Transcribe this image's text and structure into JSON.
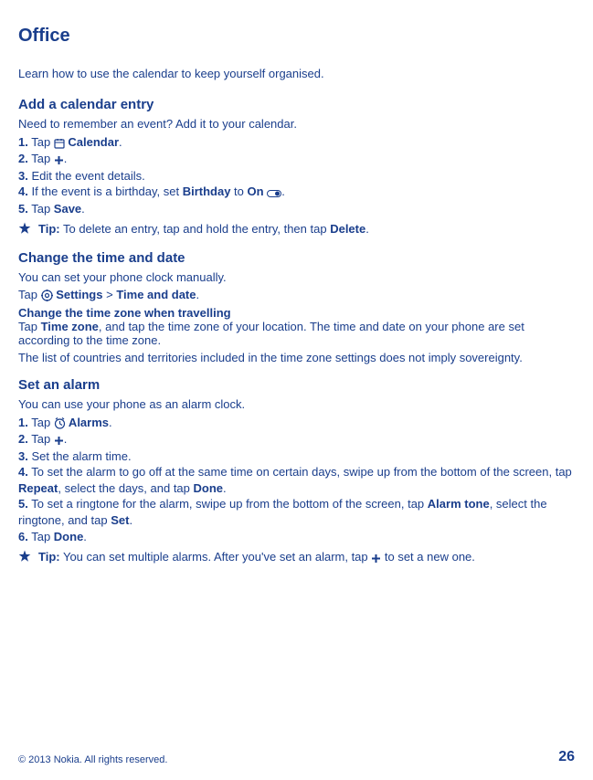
{
  "title": "Office",
  "intro": "Learn how to use the calendar to keep yourself organised.",
  "s1": {
    "h": "Add a calendar entry",
    "desc": "Need to remember an event? Add it to your calendar.",
    "step1_a": "1.",
    "step1_b": " Tap ",
    "step1_c": " Calendar",
    "step1_d": ".",
    "step2_a": "2.",
    "step2_b": " Tap ",
    "step2_c": ".",
    "step3_a": "3.",
    "step3_b": " Edit the event details.",
    "step4_a": "4.",
    "step4_b": " If the event is a birthday, set ",
    "step4_c": "Birthday",
    "step4_d": " to ",
    "step4_e": "On",
    "step4_f": " ",
    "step4_g": ".",
    "step5_a": "5.",
    "step5_b": " Tap ",
    "step5_c": "Save",
    "step5_d": ".",
    "tip_a": "Tip:",
    "tip_b": " To delete an entry, tap and hold the entry, then tap ",
    "tip_c": "Delete",
    "tip_d": "."
  },
  "s2": {
    "h": "Change the time and date",
    "desc": "You can set your phone clock manually.",
    "nav_a": "Tap ",
    "nav_b": " Settings",
    "nav_c": " > ",
    "nav_d": "Time and date",
    "nav_e": ".",
    "sub_h": "Change the time zone when travelling",
    "sub_a": "Tap ",
    "sub_b": "Time zone",
    "sub_c": ", and tap the time zone of your location. The time and date on your phone are set according to the time zone.",
    "note": "The list of countries and territories included in the time zone settings does not imply sovereignty."
  },
  "s3": {
    "h": "Set an alarm",
    "desc": "You can use your phone as an alarm clock.",
    "step1_a": "1.",
    "step1_b": " Tap ",
    "step1_c": " Alarms",
    "step1_d": ".",
    "step2_a": "2.",
    "step2_b": " Tap ",
    "step2_c": ".",
    "step3_a": "3.",
    "step3_b": " Set the alarm time.",
    "step4_a": "4.",
    "step4_b": " To set the alarm to go off at the same time on certain days, swipe up from the bottom of the screen, tap ",
    "step4_c": "Repeat",
    "step4_d": ", select the days, and tap ",
    "step4_e": "Done",
    "step4_f": ".",
    "step5_a": "5.",
    "step5_b": " To set a ringtone for the alarm, swipe up from the bottom of the screen, tap ",
    "step5_c": "Alarm tone",
    "step5_d": ", select the ringtone, and tap ",
    "step5_e": "Set",
    "step5_f": ".",
    "step6_a": "6.",
    "step6_b": " Tap ",
    "step6_c": "Done",
    "step6_d": ".",
    "tip_a": "Tip:",
    "tip_b": " You can set multiple alarms. After you've set an alarm, tap ",
    "tip_c": " to set a new one."
  },
  "footer": {
    "copyright": "© 2013 Nokia. All rights reserved.",
    "page": "26"
  }
}
